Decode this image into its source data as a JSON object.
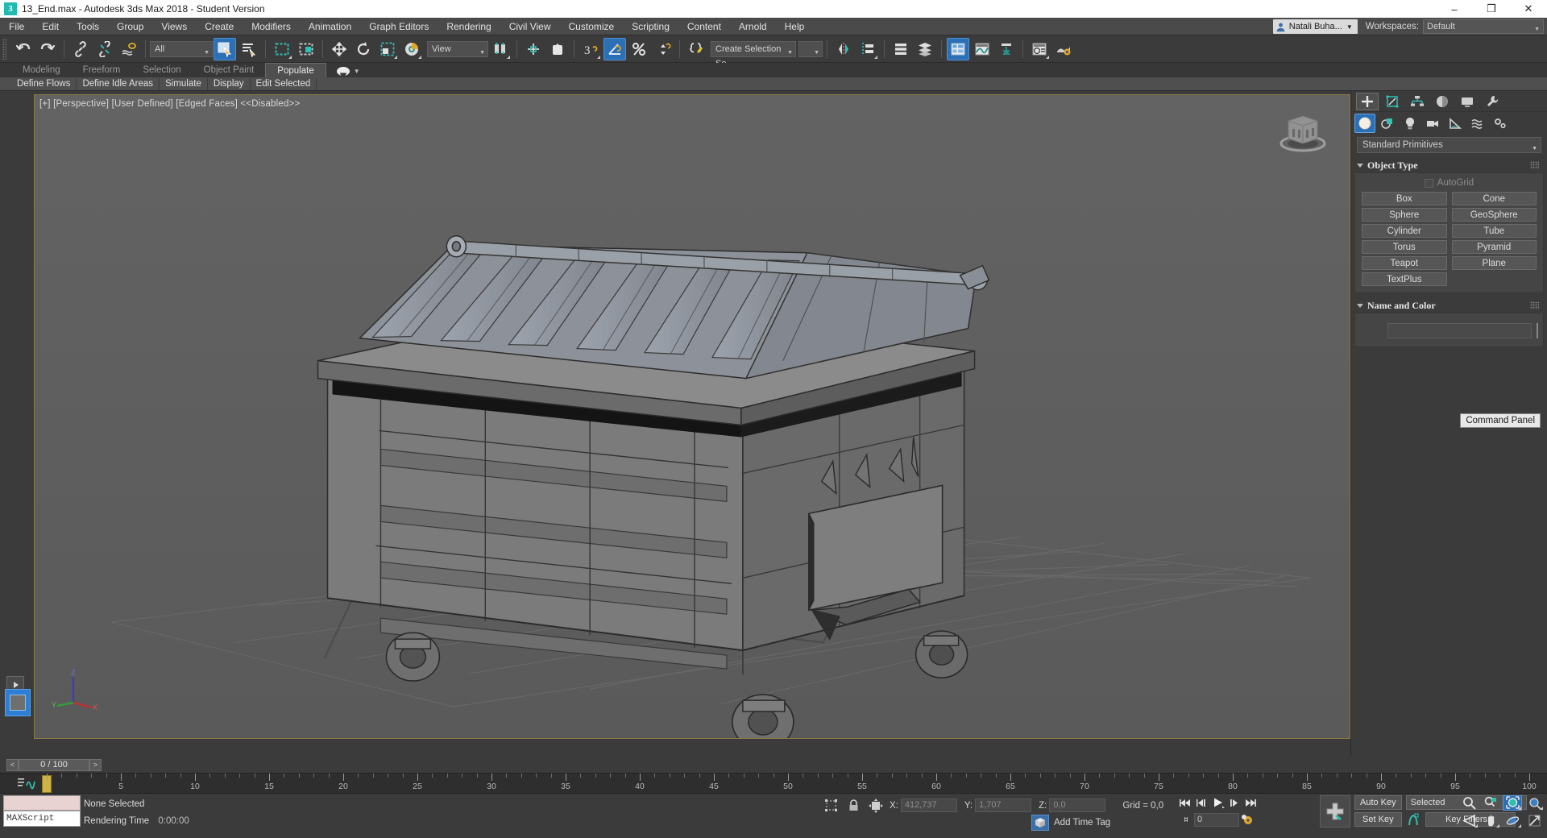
{
  "titlebar": {
    "app_icon": "3dsmax-icon",
    "title": "13_End.max - Autodesk 3ds Max 2018 - Student Version",
    "minimize": "–",
    "maximize": "❐",
    "close": "✕"
  },
  "menubar": {
    "items": [
      {
        "label": "File"
      },
      {
        "label": "Edit"
      },
      {
        "label": "Tools"
      },
      {
        "label": "Group"
      },
      {
        "label": "Views"
      },
      {
        "label": "Create"
      },
      {
        "label": "Modifiers"
      },
      {
        "label": "Animation"
      },
      {
        "label": "Graph Editors"
      },
      {
        "label": "Rendering"
      },
      {
        "label": "Civil View"
      },
      {
        "label": "Customize"
      },
      {
        "label": "Scripting"
      },
      {
        "label": "Content"
      },
      {
        "label": "Arnold"
      },
      {
        "label": "Help"
      }
    ],
    "user_name": "Natali Buha...",
    "workspaces_label": "Workspaces:",
    "workspace_value": "Default"
  },
  "toolbar": {
    "selection_filter": "All",
    "reference_coord": "View",
    "selection_set": "Create Selection Se",
    "buttons": [
      {
        "name": "undo-button"
      },
      {
        "name": "redo-button"
      },
      {
        "name": "select-and-link-button"
      },
      {
        "name": "unlink-selection-button"
      },
      {
        "name": "bind-to-space-warp-button"
      },
      {
        "name": "select-object-button"
      },
      {
        "name": "select-by-name-button"
      },
      {
        "name": "rectangular-selection-region-button"
      },
      {
        "name": "window-crossing-button"
      },
      {
        "name": "select-and-move-button"
      },
      {
        "name": "select-and-rotate-button"
      },
      {
        "name": "select-and-scale-button"
      },
      {
        "name": "select-and-place-button"
      },
      {
        "name": "use-center-flyout-button"
      },
      {
        "name": "use-selection-center-button"
      },
      {
        "name": "snaps-toggle-button"
      },
      {
        "name": "angle-snap-toggle-button"
      },
      {
        "name": "percent-snap-toggle-button"
      },
      {
        "name": "spinner-snap-toggle-button"
      },
      {
        "name": "edit-named-selection-sets-button"
      },
      {
        "name": "mirror-button"
      },
      {
        "name": "align-button"
      },
      {
        "name": "layer-explorer-button"
      },
      {
        "name": "scene-explorer-button"
      },
      {
        "name": "toggle-ribbon-button"
      },
      {
        "name": "curve-editor-button"
      },
      {
        "name": "schematic-view-button"
      },
      {
        "name": "material-editor-button"
      },
      {
        "name": "render-setup-button"
      }
    ]
  },
  "ribbon": {
    "tabs": [
      {
        "label": "Modeling",
        "active": false
      },
      {
        "label": "Freeform",
        "active": false
      },
      {
        "label": "Selection",
        "active": false
      },
      {
        "label": "Object Paint",
        "active": false
      },
      {
        "label": "Populate",
        "active": true
      }
    ],
    "subtabs": [
      {
        "label": "Define Flows"
      },
      {
        "label": "Define Idle Areas"
      },
      {
        "label": "Simulate"
      },
      {
        "label": "Display"
      },
      {
        "label": "Edit Selected"
      }
    ]
  },
  "viewport": {
    "label": "[+] [Perspective] [User Defined] [Edged Faces]  <<Disabled>>",
    "viewcube_name": "viewcube",
    "axis_x": "X",
    "axis_y": "Y",
    "axis_z": "Z",
    "model": "dumpster-mesh"
  },
  "command_panel": {
    "tabs": [
      {
        "name": "create-tab",
        "active": true
      },
      {
        "name": "modify-tab",
        "active": false
      },
      {
        "name": "hierarchy-tab",
        "active": false
      },
      {
        "name": "motion-tab",
        "active": false
      },
      {
        "name": "display-tab",
        "active": false
      },
      {
        "name": "utilities-tab",
        "active": false
      }
    ],
    "categories": [
      {
        "name": "geometry-category",
        "active": true
      },
      {
        "name": "shapes-category",
        "active": false
      },
      {
        "name": "lights-category",
        "active": false
      },
      {
        "name": "cameras-category",
        "active": false
      },
      {
        "name": "helpers-category",
        "active": false
      },
      {
        "name": "space-warps-category",
        "active": false
      },
      {
        "name": "systems-category",
        "active": false
      }
    ],
    "subcategory": "Standard Primitives",
    "object_type": {
      "title": "Object Type",
      "autogrid_label": "AutoGrid",
      "buttons": [
        "Box",
        "Cone",
        "Sphere",
        "GeoSphere",
        "Cylinder",
        "Tube",
        "Torus",
        "Pyramid",
        "Teapot",
        "Plane",
        "TextPlus"
      ]
    },
    "name_and_color": {
      "title": "Name and Color",
      "name_value": "",
      "color": "#ee2e96"
    },
    "tooltip": "Command Panel"
  },
  "timebar": {
    "prev_label": "<",
    "next_label": ">",
    "frame_field": "0 / 100",
    "ruler_min": 0,
    "ruler_max": 100,
    "ruler_step": 5,
    "ruler_labels": [
      5,
      10,
      15,
      20,
      25,
      30,
      35,
      40,
      45,
      50,
      55,
      60,
      65,
      70,
      75,
      80,
      85,
      90,
      95,
      100
    ],
    "slider_frame": 0
  },
  "statusbar": {
    "maxscript_mini": "MAXScript Mini",
    "selection_status": "None Selected",
    "rendering_time_label": "Rendering Time",
    "rendering_time_value": "0:00:00",
    "coords": {
      "x_label": "X:",
      "x_value": "412,737",
      "y_label": "Y:",
      "y_value": "1,707",
      "z_label": "Z:",
      "z_value": "0,0",
      "grid": "Grid = 0,0"
    },
    "add_time_tag": "Add Time Tag",
    "frame_value": "0",
    "auto_key": "Auto Key",
    "set_key": "Set Key",
    "key_mode": "Selected",
    "key_filters": "Key Filters...",
    "playback": [
      {
        "name": "go-to-start-button",
        "glyph": "⏮"
      },
      {
        "name": "previous-frame-button",
        "glyph": "◀"
      },
      {
        "name": "play-animation-button",
        "glyph": "▶"
      },
      {
        "name": "next-frame-button",
        "glyph": "▶"
      },
      {
        "name": "go-to-end-button",
        "glyph": "⏭"
      }
    ],
    "nav_buttons": [
      {
        "name": "zoom-button"
      },
      {
        "name": "zoom-all-button"
      },
      {
        "name": "zoom-extents-button"
      },
      {
        "name": "zoom-region-button"
      },
      {
        "name": "field-of-view-button"
      },
      {
        "name": "pan-view-button"
      },
      {
        "name": "orbit-button"
      },
      {
        "name": "maximize-viewport-toggle-button"
      }
    ]
  }
}
